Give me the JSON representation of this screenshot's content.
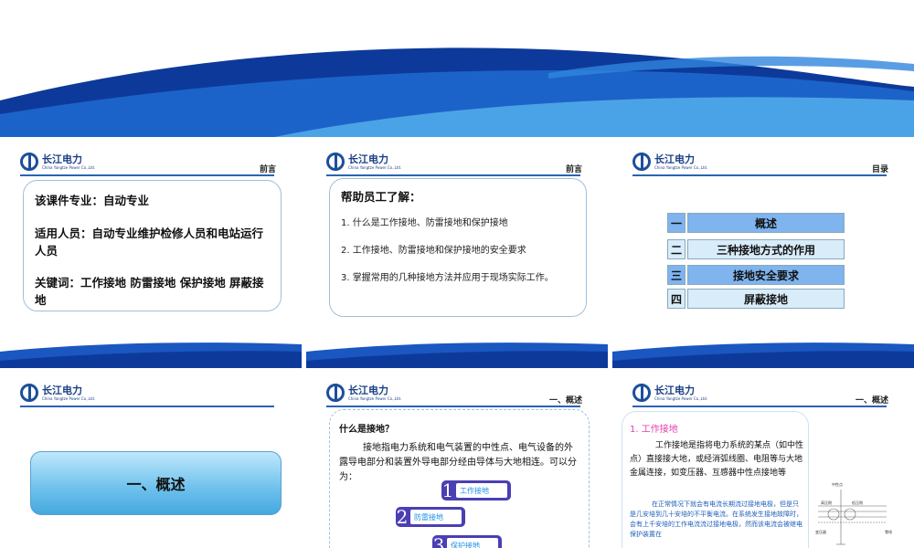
{
  "logo": {
    "cn": "长江电力",
    "en": "China Yangtze Power Co.,Ltd."
  },
  "slides": {
    "s1": {
      "section": "前言",
      "lines": [
        "该课件专业：自动专业",
        "适用人员：自动专业维护检修人员和电站运行人员",
        "关键词：工作接地  防雷接地  保护接地  屏蔽接地"
      ]
    },
    "s2": {
      "section": "前言",
      "heading": "帮助员工了解：",
      "items": [
        "1.   什么是工作接地、防雷接地和保护接地",
        "2.   工作接地、防雷接地和保护接地的安全要求",
        "3.   掌握常用的几种接地方法并应用于现场实际工作。"
      ]
    },
    "s3": {
      "section": "目录",
      "toc": [
        {
          "num": "一",
          "label": "概述"
        },
        {
          "num": "二",
          "label": "三种接地方式的作用"
        },
        {
          "num": "三",
          "label": "接地安全要求"
        },
        {
          "num": "四",
          "label": "屏蔽接地"
        }
      ]
    },
    "s4": {
      "title": "一、概述"
    },
    "s5": {
      "section": "一、概述",
      "question": "什么是接地？",
      "body": "接地指电力系统和电气装置的中性点、电气设备的外露导电部分和装置外导电部分经由导体与大地相连。可以分为：",
      "pills": [
        {
          "num": "1",
          "label": "工作接地"
        },
        {
          "num": "2",
          "label": "防雷接地"
        },
        {
          "num": "3",
          "label": "保护接地"
        }
      ]
    },
    "s6": {
      "section": "一、概述",
      "subtitle": "1.  工作接地",
      "body": "工作接地是指将电力系统的某点（如中性点）直接接大地，或经消弧线圈、电阻等与大地金属连接，如变压器、互感器中性点接地等",
      "note": "在正常情况下就会有电流长期流过接地电极，但是只是几安培到几十安培的不平衡电流。在系统发生接地故障时，会有上千安培的工作电流流过接地电极，然而该电流会被继电保护装置在",
      "diagram_labels": [
        "中性点",
        "高压侧",
        "低压侧",
        "变压器",
        "零线"
      ]
    }
  }
}
